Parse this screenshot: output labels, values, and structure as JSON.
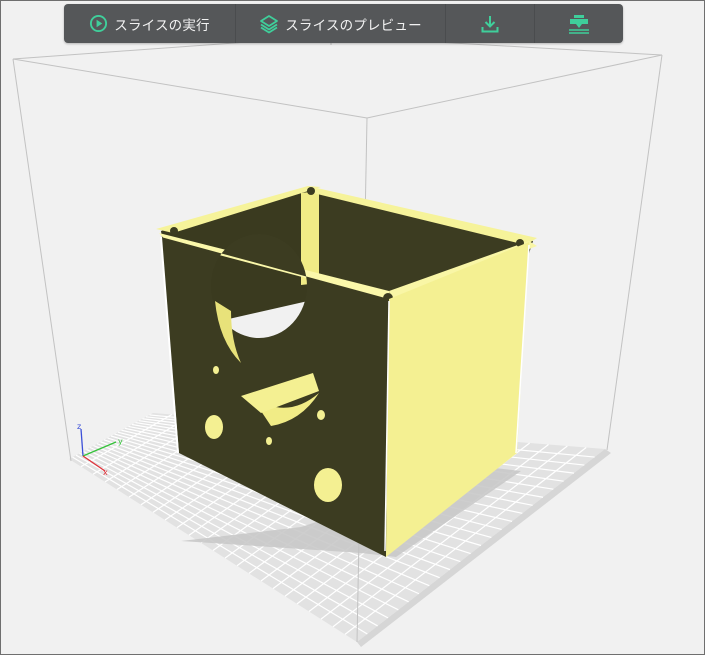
{
  "toolbar": {
    "slice_run_label": "スライスの実行",
    "slice_preview_label": "スライスのプレビュー",
    "icons": {
      "slice_run": "play-circle-icon",
      "slice_preview": "layers-icon",
      "download": "download-icon",
      "send_to_printer": "printer-nozzle-icon"
    },
    "accent_color": "#3fcf9b"
  },
  "viewport": {
    "model_color": "#f4f092",
    "model_shadow_color": "#3c3c21",
    "bed_color": "#e2e2e2",
    "grid_color": "#ffffff",
    "axes": [
      {
        "label": "z",
        "color": "#3b4fd8"
      },
      {
        "label": "y",
        "color": "#35c23a"
      },
      {
        "label": "x",
        "color": "#e0323a"
      }
    ]
  }
}
